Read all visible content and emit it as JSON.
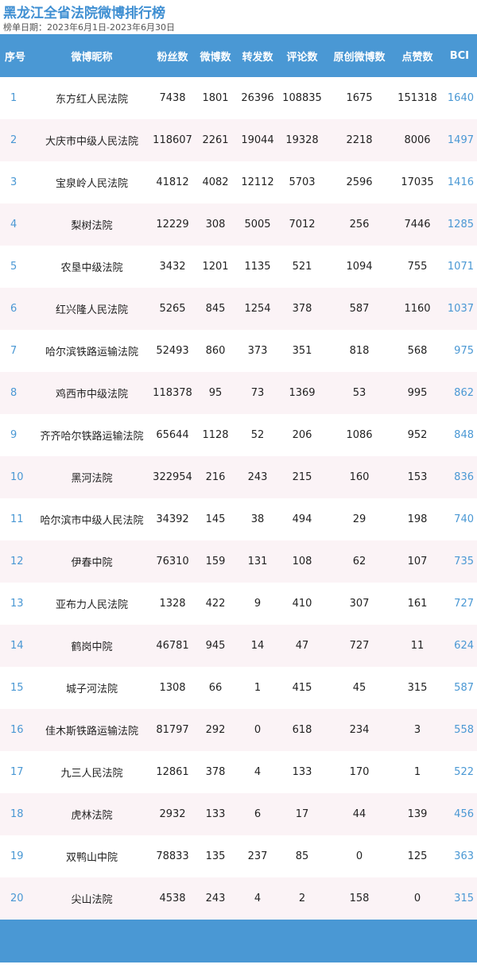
{
  "title": "黑龙江全省法院微博排行榜",
  "subtitle": "榜单日期：2023年6月1日-2023年6月30日",
  "colors": {
    "header_bg": "#4a98d4",
    "accent_text": "#4a98d4",
    "title": "#3f8fd2",
    "stripe": "#fbf3f6"
  },
  "table": {
    "headers": [
      "序号",
      "微博昵称",
      "粉丝数",
      "微博数",
      "转发数",
      "评论数",
      "原创微博数",
      "点赞数",
      "BCI"
    ],
    "rows": [
      [
        "1",
        "东方红人民法院",
        "7438",
        "1801",
        "26396",
        "108835",
        "1675",
        "151318",
        "1640"
      ],
      [
        "2",
        "大庆市中级人民法院",
        "118607",
        "2261",
        "19044",
        "19328",
        "2218",
        "8006",
        "1497"
      ],
      [
        "3",
        "宝泉岭人民法院",
        "41812",
        "4082",
        "12112",
        "5703",
        "2596",
        "17035",
        "1416"
      ],
      [
        "4",
        "梨树法院",
        "12229",
        "308",
        "5005",
        "7012",
        "256",
        "7446",
        "1285"
      ],
      [
        "5",
        "农垦中级法院",
        "3432",
        "1201",
        "1135",
        "521",
        "1094",
        "755",
        "1071"
      ],
      [
        "6",
        "红兴隆人民法院",
        "5265",
        "845",
        "1254",
        "378",
        "587",
        "1160",
        "1037"
      ],
      [
        "7",
        "哈尔滨铁路运输法院",
        "52493",
        "860",
        "373",
        "351",
        "818",
        "568",
        "975"
      ],
      [
        "8",
        "鸡西市中级法院",
        "118378",
        "95",
        "73",
        "1369",
        "53",
        "995",
        "862"
      ],
      [
        "9",
        "齐齐哈尔铁路运输法院",
        "65644",
        "1128",
        "52",
        "206",
        "1086",
        "952",
        "848"
      ],
      [
        "10",
        "黑河法院",
        "322954",
        "216",
        "243",
        "215",
        "160",
        "153",
        "836"
      ],
      [
        "11",
        "哈尔滨市中级人民法院",
        "34392",
        "145",
        "38",
        "494",
        "29",
        "198",
        "740"
      ],
      [
        "12",
        "伊春中院",
        "76310",
        "159",
        "131",
        "108",
        "62",
        "107",
        "735"
      ],
      [
        "13",
        "亚布力人民法院",
        "1328",
        "422",
        "9",
        "410",
        "307",
        "161",
        "727"
      ],
      [
        "14",
        "鹤岗中院",
        "46781",
        "945",
        "14",
        "47",
        "727",
        "11",
        "624"
      ],
      [
        "15",
        "城子河法院",
        "1308",
        "66",
        "1",
        "415",
        "45",
        "315",
        "587"
      ],
      [
        "16",
        "佳木斯铁路运输法院",
        "81797",
        "292",
        "0",
        "618",
        "234",
        "3",
        "558"
      ],
      [
        "17",
        "九三人民法院",
        "12861",
        "378",
        "4",
        "133",
        "170",
        "1",
        "522"
      ],
      [
        "18",
        "虎林法院",
        "2932",
        "133",
        "6",
        "17",
        "44",
        "139",
        "456"
      ],
      [
        "19",
        "双鸭山中院",
        "78833",
        "135",
        "237",
        "85",
        "0",
        "125",
        "363"
      ],
      [
        "20",
        "尖山法院",
        "4538",
        "243",
        "4",
        "2",
        "158",
        "0",
        "315"
      ]
    ]
  }
}
